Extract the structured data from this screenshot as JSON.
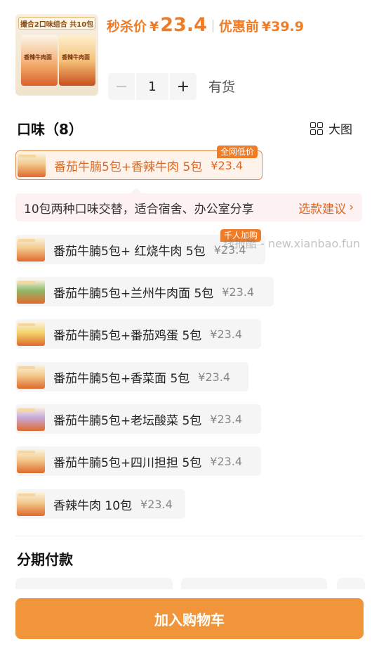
{
  "product": {
    "thumb_banner": "撮合2口味组合 共10包",
    "thumb_label_a": "香辣牛肉面",
    "thumb_label_b": "香辣牛肉面"
  },
  "price": {
    "flash_label": "秒杀价",
    "currency": "¥",
    "flash_value": "23.4",
    "original_label": "优惠前",
    "original_value": "¥39.9",
    "accent_color": "#ef7c26"
  },
  "quantity": {
    "minus": "−",
    "value": "1",
    "plus": "+",
    "stock": "有货"
  },
  "flavors": {
    "title": "口味（8）",
    "big_view": "大图",
    "selected_tag": "全网低价",
    "items": [
      {
        "name": "番茄牛腩5包+香辣牛肉 5包",
        "price": "¥23.4",
        "selected": true
      },
      {
        "name": "番茄牛腩5包+ 红烧牛肉 5包",
        "price": "¥23.4",
        "tag": "千人加购"
      },
      {
        "name": "番茄牛腩5包+兰州牛肉面 5包",
        "price": "¥23.4"
      },
      {
        "name": "番茄牛腩5包+番茄鸡蛋 5包",
        "price": "¥23.4"
      },
      {
        "name": "番茄牛腩5包+香菜面 5包",
        "price": "¥23.4"
      },
      {
        "name": "番茄牛腩5包+老坛酸菜 5包",
        "price": "¥23.4"
      },
      {
        "name": "番茄牛腩5包+四川担担 5包",
        "price": "¥23.4"
      },
      {
        "name": "香辣牛肉 10包",
        "price": "¥23.4"
      }
    ]
  },
  "tip": {
    "text": "10包两种口味交替，适合宿舍、办公室分享",
    "link": "选款建议",
    "chevron": "›"
  },
  "watermark": "线报酷 - new.xianbao.fun",
  "installment": {
    "title": "分期付款"
  },
  "cart": {
    "label": "加入购物车"
  }
}
